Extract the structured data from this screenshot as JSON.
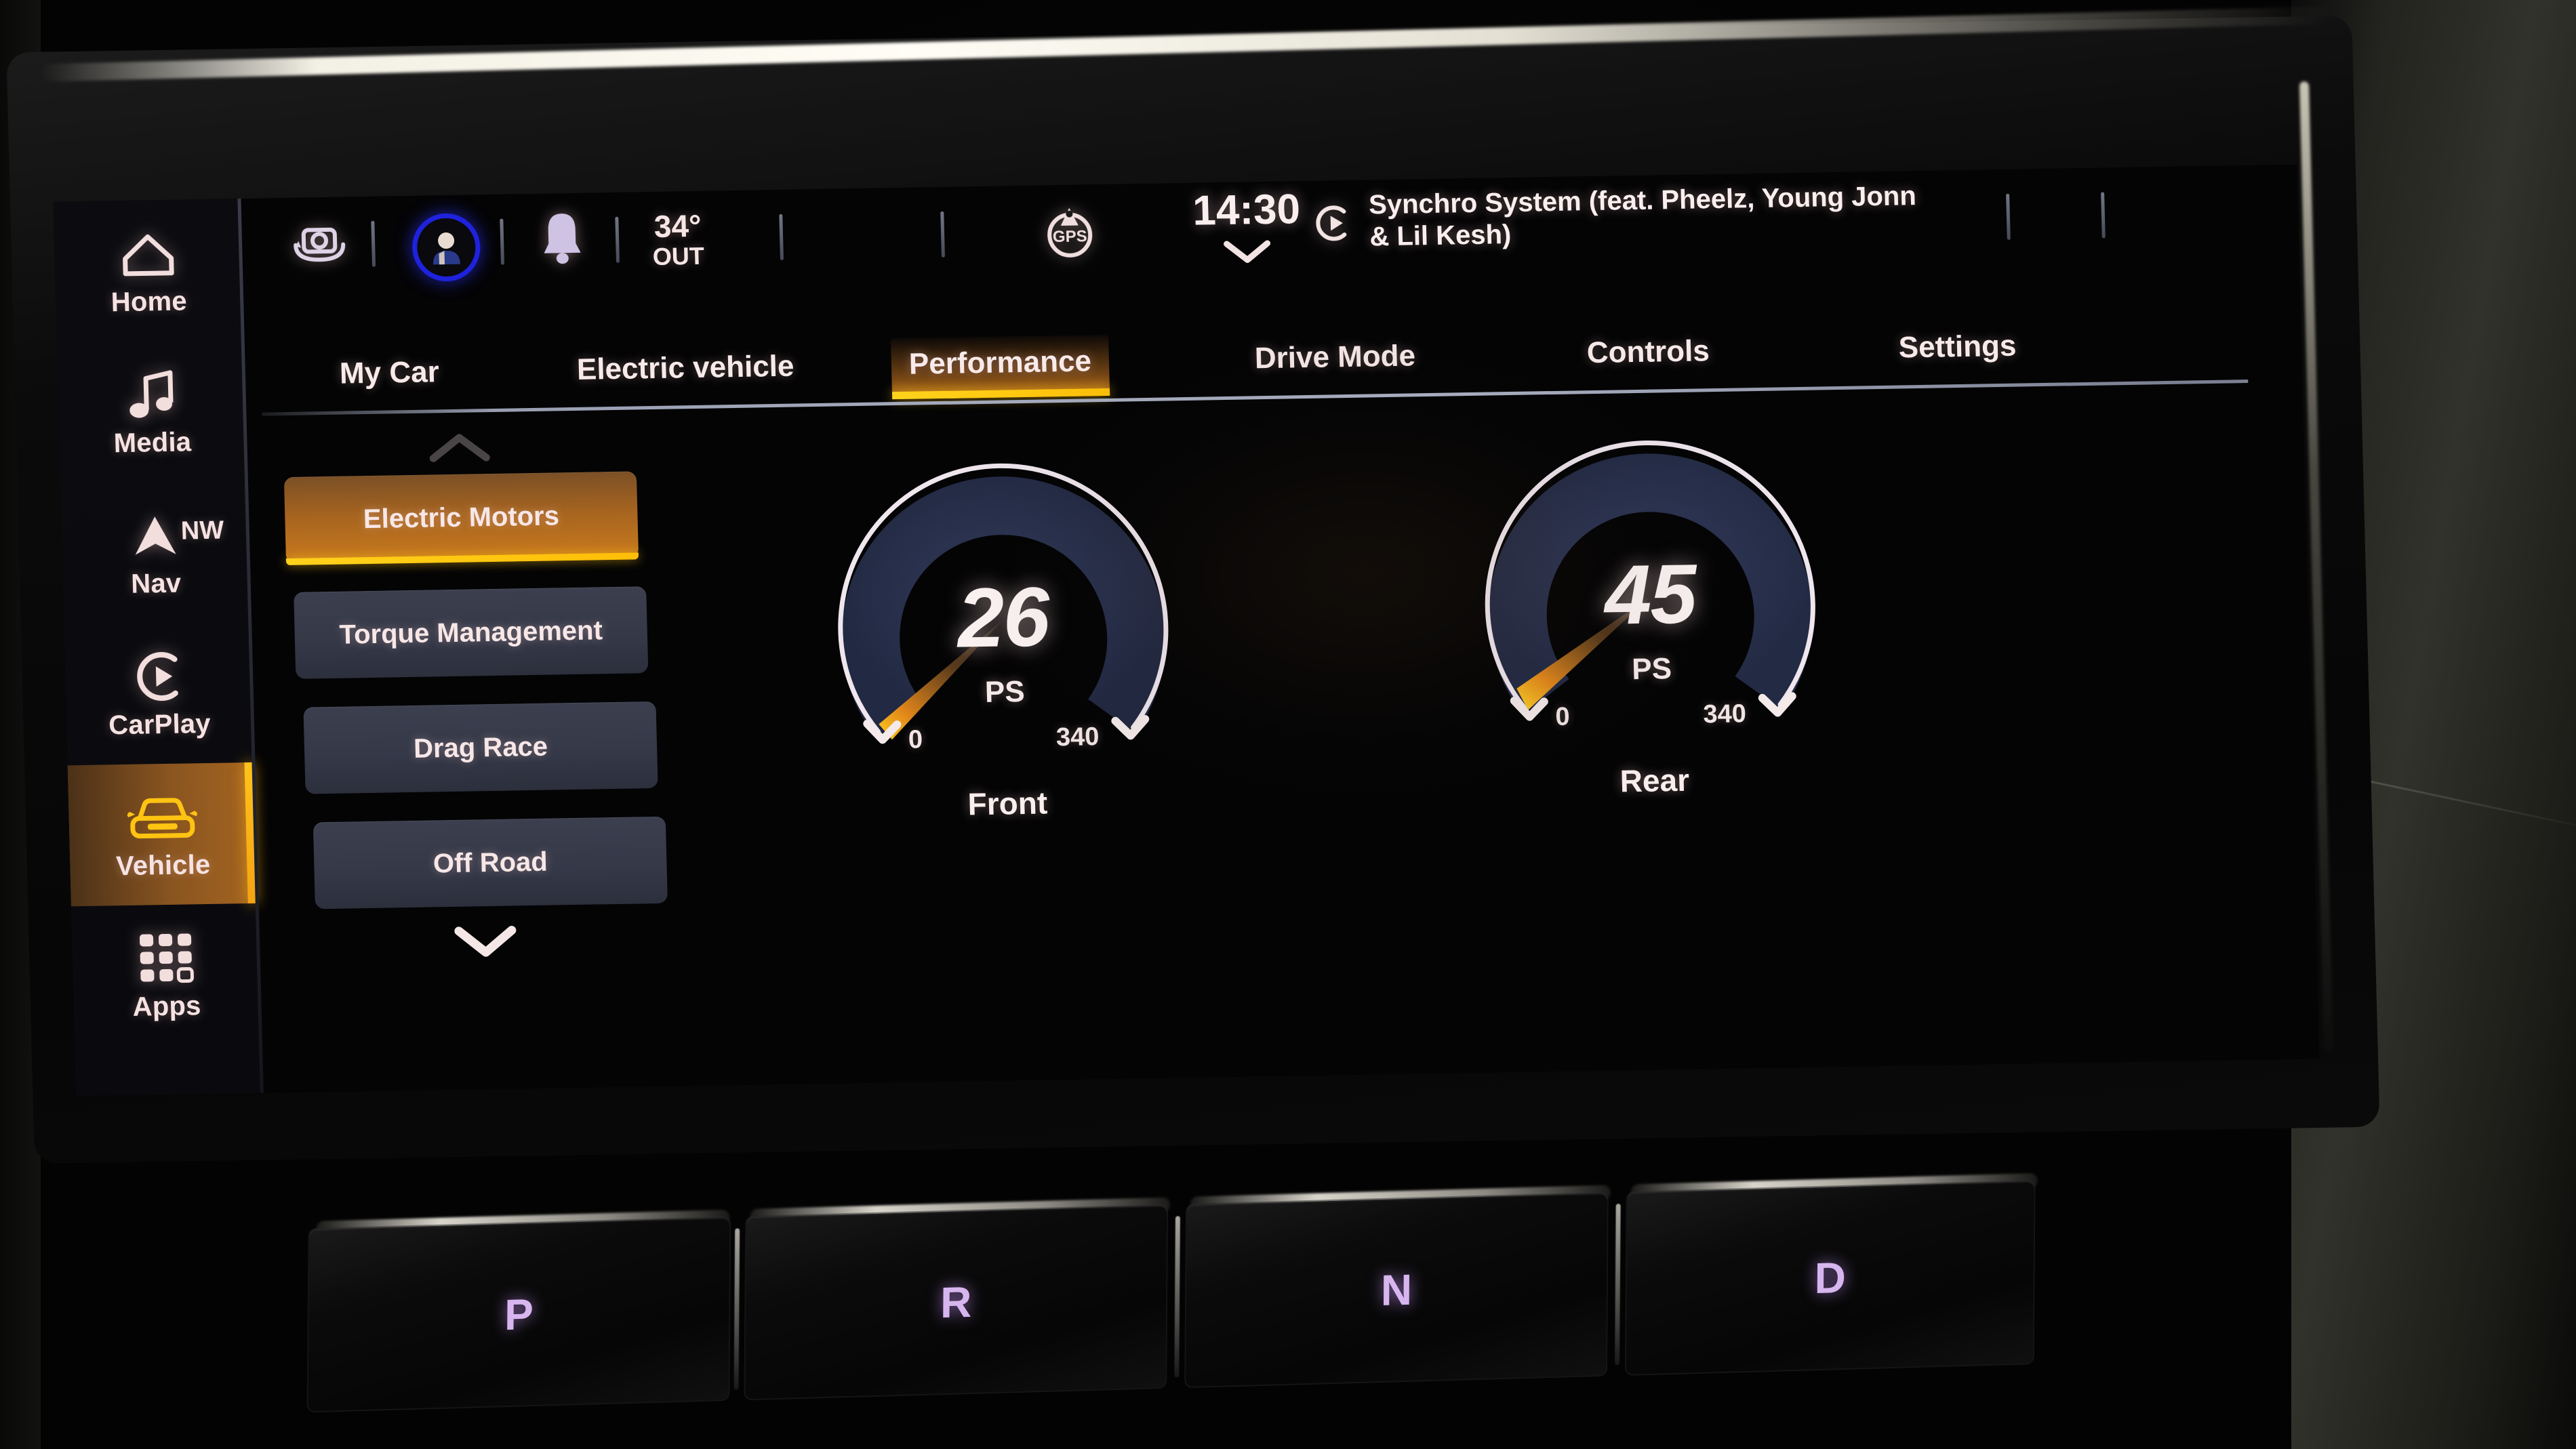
{
  "sidebar": {
    "items": [
      {
        "label": "Home",
        "icon": "home-icon",
        "active": false
      },
      {
        "label": "Media",
        "icon": "music-note-icon",
        "active": false
      },
      {
        "label": "Nav",
        "icon": "navigation-arrow-icon",
        "active": false,
        "badge": "NW"
      },
      {
        "label": "CarPlay",
        "icon": "carplay-icon",
        "active": false
      },
      {
        "label": "Vehicle",
        "icon": "car-front-icon",
        "active": true
      },
      {
        "label": "Apps",
        "icon": "apps-grid-icon",
        "active": false
      }
    ]
  },
  "status_bar": {
    "camera_icon": "camera-360-icon",
    "profile_icon": "user-avatar-icon",
    "notification_icon": "bell-icon",
    "temperature": "34°",
    "temperature_label": "OUT",
    "gps_icon": "gps-icon",
    "gps_label": "GPS",
    "clock": "14:30",
    "clock_expand_icon": "chevron-down-icon",
    "media_icon": "carplay-play-icon",
    "now_playing": "Synchro System (feat. Pheelz, Young Jonn & Lil Kesh)"
  },
  "tabs": [
    {
      "label": "My Car",
      "active": false
    },
    {
      "label": "Electric vehicle",
      "active": false
    },
    {
      "label": "Performance",
      "active": true
    },
    {
      "label": "Drive Mode",
      "active": false
    },
    {
      "label": "Controls",
      "active": false
    },
    {
      "label": "Settings",
      "active": false
    }
  ],
  "option_list": {
    "scroll_up_icon": "chevron-up-icon",
    "scroll_down_icon": "chevron-down-icon",
    "items": [
      {
        "label": "Electric Motors",
        "selected": true
      },
      {
        "label": "Torque Management",
        "selected": false
      },
      {
        "label": "Drag Race",
        "selected": false
      },
      {
        "label": "Off Road",
        "selected": false
      }
    ]
  },
  "gear_selector": {
    "positions": [
      {
        "label": "P"
      },
      {
        "label": "R"
      },
      {
        "label": "N"
      },
      {
        "label": "D"
      }
    ]
  },
  "colors": {
    "accent_yellow": "#ffc81a",
    "accent_orange": "#c97a1e",
    "gauge_arc": "#2b3350",
    "gauge_needle": "#ffc21a",
    "text_primary": "#fbeeee",
    "gear_text": "#d7b6ef",
    "profile_ring": "#1f22dd"
  },
  "chart_data": [
    {
      "type": "gauge",
      "title": "Front",
      "value": 26,
      "unit": "PS",
      "min": 0,
      "max": 340,
      "min_label": "0",
      "max_label": "340",
      "arc_start_deg": -215,
      "arc_sweep_deg": 250,
      "arc_color": "#2b3350",
      "needle_color": "#ffc21a"
    },
    {
      "type": "gauge",
      "title": "Rear",
      "value": 45,
      "unit": "PS",
      "min": 0,
      "max": 340,
      "min_label": "0",
      "max_label": "340",
      "arc_start_deg": -215,
      "arc_sweep_deg": 250,
      "arc_color": "#2b3350",
      "needle_color": "#ffc21a"
    }
  ]
}
